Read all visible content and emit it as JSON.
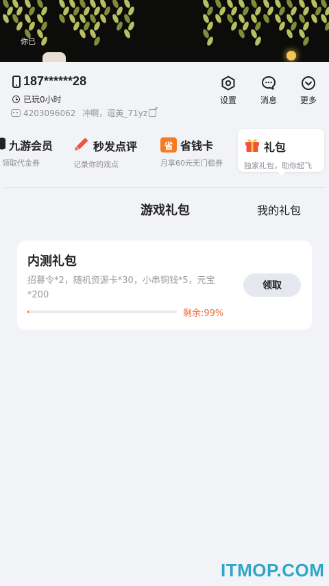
{
  "banner": {
    "text": "你已"
  },
  "user": {
    "phone": "187******28",
    "played": "已玩0小时",
    "user_id": "4203096062",
    "nickname": "冲啊，逗英_71yz"
  },
  "actions": [
    {
      "label": "设置",
      "icon": "gear-icon"
    },
    {
      "label": "消息",
      "icon": "chat-bubble-icon"
    },
    {
      "label": "更多",
      "icon": "chevron-down-icon"
    }
  ],
  "quick": [
    {
      "title": "九游会员",
      "sub": "领取代金券",
      "icon": "vip-icon"
    },
    {
      "title": "秒发点评",
      "sub": "记录你的观点",
      "icon": "pencil-icon"
    },
    {
      "title": "省钱卡",
      "sub": "月享60元无门槛券",
      "icon": "save-card-icon",
      "icon_char": "省"
    },
    {
      "title": "礼包",
      "sub": "独家礼包，助你起飞",
      "icon": "gift-icon"
    }
  ],
  "panel": {
    "title": "游戏礼包",
    "my_gift": "我的礼包"
  },
  "gift_card": {
    "title": "内测礼包",
    "desc": "招募令*2，随机资源卡*30，小串铜钱*5，元宝*200",
    "button": "领取",
    "remaining_label": "剩余:99%",
    "used_fraction": 0.01
  },
  "watermark": "ITMOP.COM",
  "colors": {
    "accent": "#f26b35",
    "watermark": "#2ea6c7",
    "gift": "#f0523f",
    "card_icon": "#f57c23"
  }
}
